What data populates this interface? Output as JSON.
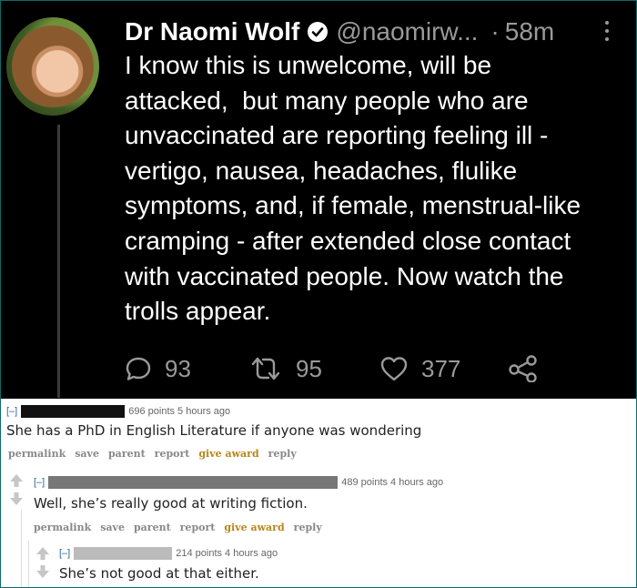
{
  "tweet": {
    "name": "Dr Naomi Wolf",
    "handle": "@naomirw...",
    "dot": "·",
    "time": "58m",
    "lines": [
      "I know this is unwelcome, will be",
      "attacked,  but many people who are",
      "unvaccinated are reporting feeling ill -",
      "vertigo, nausea, headaches, flulike",
      "symptoms, and, if female, menstrual-like",
      "cramping - after extended close contact",
      "with vaccinated people. Now watch the",
      "trolls appear."
    ],
    "reply_count": "93",
    "retweet_count": "95",
    "like_count": "377",
    "colors": {
      "background": "#000000",
      "muted": "#9a9a9a",
      "text": "#ffffff"
    }
  },
  "reddit": {
    "comments": [
      {
        "collapse": "[–]",
        "meta": "696 points 5 hours ago",
        "body": "She has a PhD in English Literature if anyone was wondering",
        "links": [
          "permalink",
          "save",
          "parent",
          "report",
          "give award",
          "reply"
        ]
      },
      {
        "collapse": "[–]",
        "meta": "489 points 4 hours ago",
        "body": "Well, she’s really good at writing fiction.",
        "links": [
          "permalink",
          "save",
          "parent",
          "report",
          "give award",
          "reply"
        ]
      },
      {
        "collapse": "[–]",
        "meta": "214 points 4 hours ago",
        "body": "She’s not good at that either."
      }
    ],
    "colors": {
      "link": "#888888",
      "award": "#b8861b",
      "collapse": "#336699"
    }
  }
}
